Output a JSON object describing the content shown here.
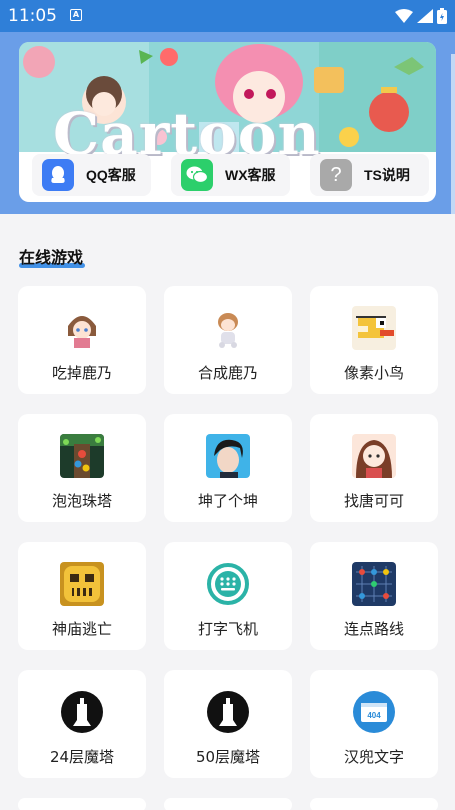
{
  "status_bar": {
    "time": "11:05",
    "notification": "A"
  },
  "banner": {
    "title": "Cartoon"
  },
  "services": [
    {
      "label": "QQ客服",
      "icon": "qq-icon",
      "color": "#3d7cf4"
    },
    {
      "label": "WX客服",
      "icon": "wechat-icon",
      "color": "#2ccf6b"
    },
    {
      "label": "TS说明",
      "icon": "question-icon",
      "color": "#a9a9a9"
    }
  ],
  "section": {
    "title": "在线游戏",
    "accent": "#2f86e6"
  },
  "games": [
    {
      "label": "吃掉鹿乃",
      "icon": "anime-girl-icon"
    },
    {
      "label": "合成鹿乃",
      "icon": "chibi-girl-icon"
    },
    {
      "label": "像素小鸟",
      "icon": "flappy-bird-icon"
    },
    {
      "label": "泡泡珠塔",
      "icon": "bubble-tower-icon"
    },
    {
      "label": "坤了个坤",
      "icon": "idol-portrait-icon"
    },
    {
      "label": "找唐可可",
      "icon": "anime-brown-hair-icon"
    },
    {
      "label": "神庙逃亡",
      "icon": "temple-run-icon"
    },
    {
      "label": "打字飞机",
      "icon": "keyboard-icon"
    },
    {
      "label": "连点路线",
      "icon": "dot-grid-icon"
    },
    {
      "label": "24层魔塔",
      "icon": "tower-icon"
    },
    {
      "label": "50层魔塔",
      "icon": "tower-icon"
    },
    {
      "label": "汉兜文字",
      "icon": "404-page-icon"
    }
  ]
}
